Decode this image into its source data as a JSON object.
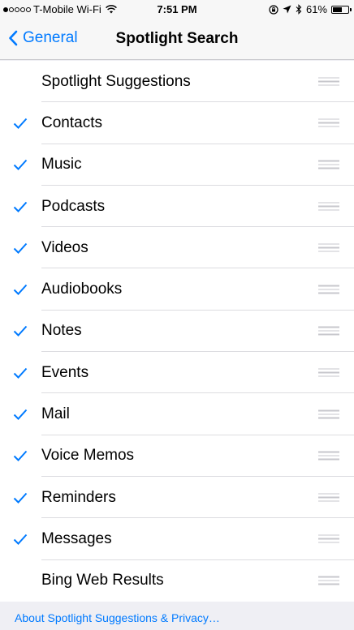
{
  "status_bar": {
    "signal_filled": 1,
    "signal_total": 5,
    "carrier": "T-Mobile Wi-Fi",
    "time": "7:51 PM",
    "battery_text": "61%",
    "battery_level": 0.61,
    "icons": [
      "lock-rotation-icon",
      "location-arrow-icon",
      "bluetooth-icon"
    ]
  },
  "nav": {
    "back_label": "General",
    "title": "Spotlight Search"
  },
  "list": {
    "items": [
      {
        "label": "Spotlight Suggestions",
        "checked": false
      },
      {
        "label": "Contacts",
        "checked": true
      },
      {
        "label": "Music",
        "checked": true
      },
      {
        "label": "Podcasts",
        "checked": true
      },
      {
        "label": "Videos",
        "checked": true
      },
      {
        "label": "Audiobooks",
        "checked": true
      },
      {
        "label": "Notes",
        "checked": true
      },
      {
        "label": "Events",
        "checked": true
      },
      {
        "label": "Mail",
        "checked": true
      },
      {
        "label": "Voice Memos",
        "checked": true
      },
      {
        "label": "Reminders",
        "checked": true
      },
      {
        "label": "Messages",
        "checked": true
      },
      {
        "label": "Bing Web Results",
        "checked": false
      }
    ]
  },
  "footer": {
    "link_text": "About Spotlight Suggestions & Privacy…"
  },
  "colors": {
    "accent": "#007aff",
    "background": "#efeff4",
    "separator": "#dcdce0",
    "grip": "#c7c7cc"
  }
}
